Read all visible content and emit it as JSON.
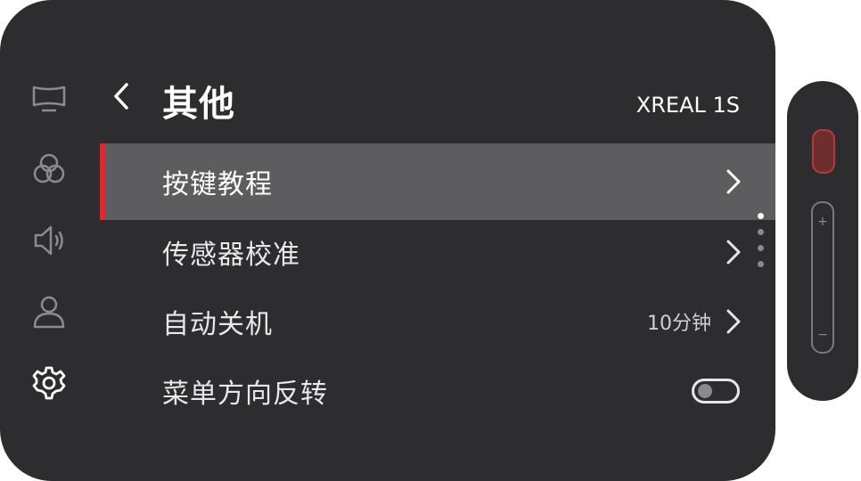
{
  "header": {
    "title": "其他",
    "device_name": "XREAL 1S"
  },
  "sidebar": {
    "items": [
      {
        "icon": "display-icon"
      },
      {
        "icon": "color-circles-icon"
      },
      {
        "icon": "speaker-icon"
      },
      {
        "icon": "user-icon"
      },
      {
        "icon": "gear-icon",
        "active": true
      }
    ]
  },
  "menu": {
    "items": [
      {
        "label": "按键教程",
        "selected": true
      },
      {
        "label": "传感器校准"
      },
      {
        "label": "自动关机",
        "value": "10分钟"
      },
      {
        "label": "菜单方向反转",
        "toggle": false
      }
    ]
  },
  "scroll_indicator": {
    "count": 4,
    "active_index": 0
  },
  "controller": {
    "plus_label": "+",
    "minus_label": "−"
  },
  "colors": {
    "panel": "#2d2d2f",
    "selected_row": "#5d5d5f",
    "accent": "#e3262b"
  }
}
